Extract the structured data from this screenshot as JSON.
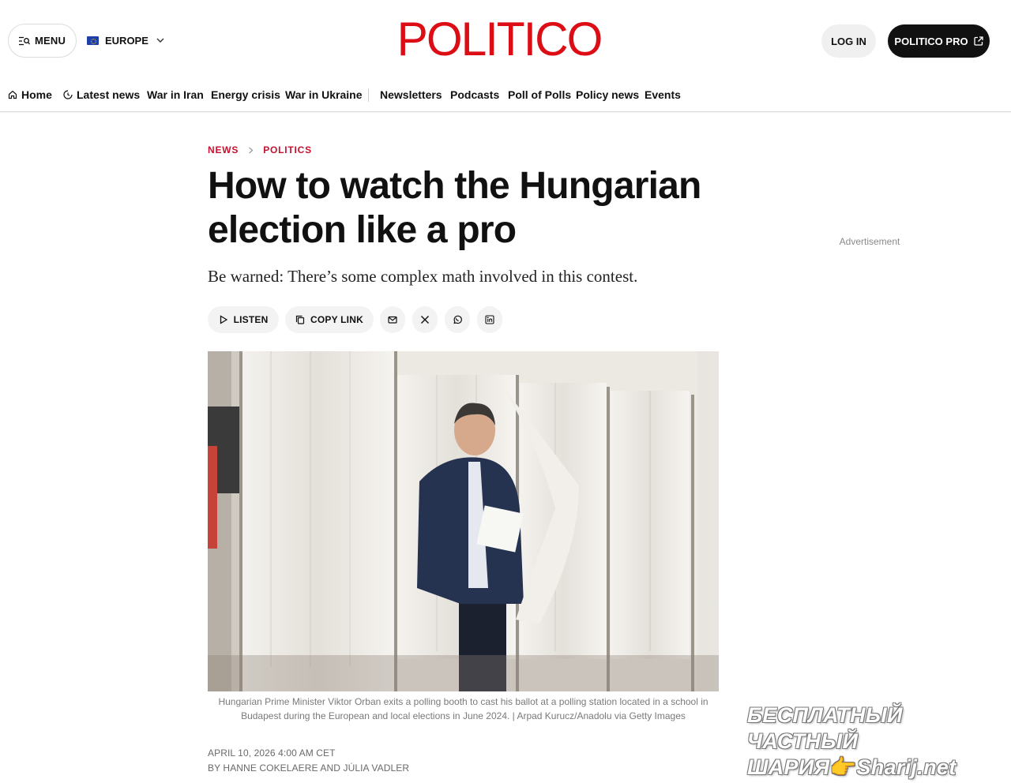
{
  "header": {
    "menu_label": "MENU",
    "edition_label": "EUROPE",
    "logo_text": "POLITICO",
    "login_label": "LOG IN",
    "pro_label": "POLITICO PRO"
  },
  "nav": {
    "items": [
      {
        "label": "Home",
        "icon": "home-icon"
      },
      {
        "label": "Latest news",
        "icon": "latest-news-icon"
      },
      {
        "label": "War in Iran"
      },
      {
        "label": "Energy crisis"
      },
      {
        "label": "War in Ukraine"
      },
      {
        "label": "Newsletters"
      },
      {
        "label": "Podcasts"
      },
      {
        "label": "Poll of Polls"
      },
      {
        "label": "Policy news"
      },
      {
        "label": "Events"
      }
    ]
  },
  "article": {
    "breadcrumb": [
      "NEWS",
      "POLITICS"
    ],
    "headline": "How to watch the Hungarian election like a pro",
    "dek": "Be warned: There’s some complex math involved in this contest.",
    "share": {
      "listen_label": "LISTEN",
      "copy_link_label": "COPY LINK",
      "icons": [
        "email-icon",
        "x-icon",
        "whatsapp-icon",
        "linkedin-icon"
      ]
    },
    "caption": "Hungarian Prime Minister Viktor Orban exits a polling booth to cast his ballot at a polling station located in a school in Budapest during the European and local elections in June 2024. | Arpad Kurucz/Anadolu via Getty Images",
    "dateline": "APRIL 10, 2026 4:00 AM CET",
    "byline": "BY HANNE COKELAERE AND JÚLIA VADLER"
  },
  "sidebar": {
    "ad_label": "Advertisement"
  },
  "watermark": {
    "line1": "БЕСПЛАТНЫЙ ЧАСТНЫЙ",
    "line2_left": "ШАРИЯ",
    "line2_right": "Sharij.net"
  },
  "colors": {
    "brand_red": "#dc0d15",
    "breadcrumb_red": "#c8102e",
    "dark_button": "#111111"
  }
}
